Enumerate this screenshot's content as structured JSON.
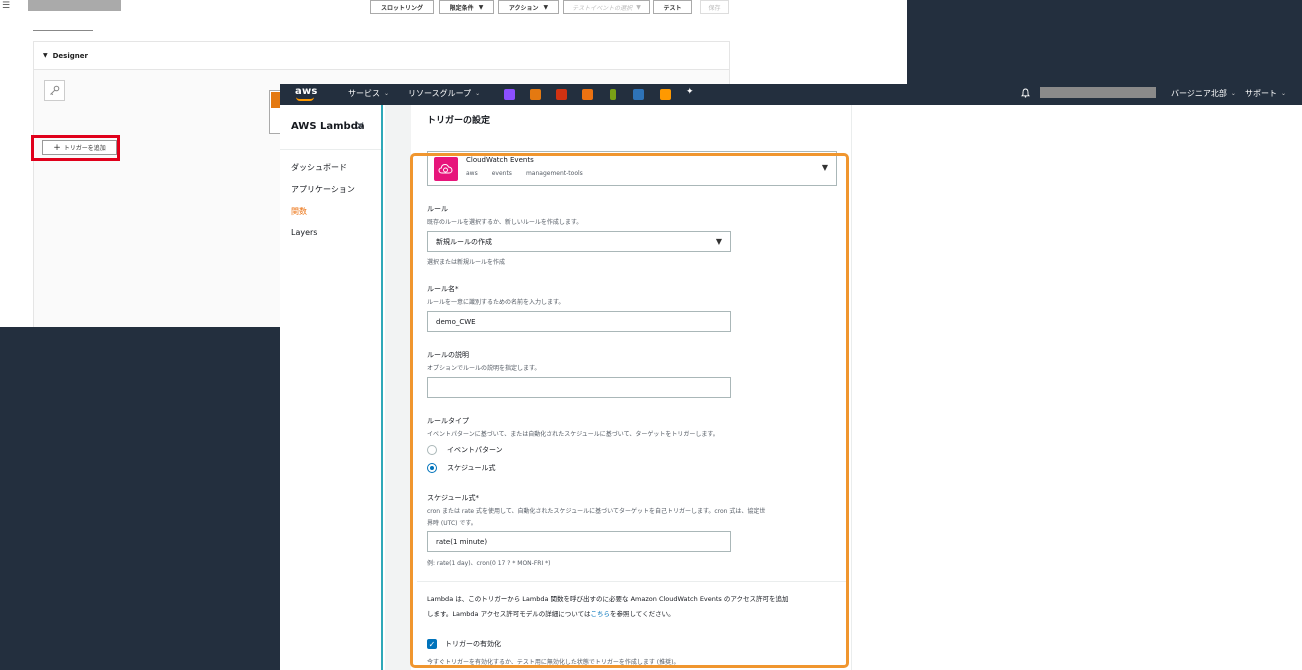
{
  "background_window": {
    "toolbar": {
      "throttling": "スロットリング",
      "qualifiers": "限定条件",
      "actions": "アクション",
      "test_event_placeholder": "テストイベントの選択",
      "test": "テスト",
      "save": "保存"
    },
    "designer_title": "Designer",
    "add_trigger": "トリガーを追加"
  },
  "topnav": {
    "logo": "aws",
    "services": "サービス",
    "resource_groups": "リソースグループ",
    "region": "バージニア北部",
    "support": "サポート",
    "service_icons": [
      {
        "name": "purple-service-icon",
        "color": "#8c4fff"
      },
      {
        "name": "orange-service-icon-1",
        "color": "#e47911"
      },
      {
        "name": "red-service-icon",
        "color": "#d13212"
      },
      {
        "name": "orange-service-icon-2",
        "color": "#ec7211"
      },
      {
        "name": "green-service-icon",
        "color": "#7aa116"
      },
      {
        "name": "blue-service-icon",
        "color": "#2e73b8"
      },
      {
        "name": "orange-service-icon-3",
        "color": "#ff9900"
      },
      {
        "name": "pin-icon",
        "color": "#ffffff"
      }
    ]
  },
  "sidebar": {
    "title": "AWS Lambda",
    "items": [
      {
        "label": "ダッシュボード",
        "active": false
      },
      {
        "label": "アプリケーション",
        "active": false
      },
      {
        "label": "関数",
        "active": true
      },
      {
        "label": "Layers",
        "active": false
      }
    ]
  },
  "trigger_config": {
    "section_title": "トリガーの設定",
    "source": {
      "name": "CloudWatch Events",
      "tags": [
        "aws",
        "events",
        "management-tools"
      ]
    },
    "rule": {
      "label": "ルール",
      "description": "既存のルールを選択するか、新しいルールを作成します。",
      "value": "新規ルールの作成",
      "hint": "選択または新規ルールを作成"
    },
    "rule_name": {
      "label": "ルール名*",
      "description": "ルールを一意に識別するための名前を入力します。",
      "value": "demo_CWE"
    },
    "rule_description": {
      "label": "ルールの説明",
      "description": "オプションでルールの説明を指定します。",
      "value": ""
    },
    "rule_type": {
      "label": "ルールタイプ",
      "description": "イベントパターンに基づいて、または自動化されたスケジュールに基づいて、ターゲットをトリガーします。",
      "options": [
        {
          "label": "イベントパターン",
          "selected": false
        },
        {
          "label": "スケジュール式",
          "selected": true
        }
      ]
    },
    "schedule_expression": {
      "label": "スケジュール式*",
      "description_line1": "cron または rate 式を使用して、自動化されたスケジュールに基づいてターゲットを自己トリガーします。cron 式は、協定世",
      "description_line2": "界時 (UTC) です。",
      "value": "rate(1 minute)",
      "example": "例: rate(1 day)、cron(0 17 ? * MON-FRI *)"
    },
    "permission_note": {
      "line1": "Lambda は、このトリガーから Lambda 関数を呼び出すのに必要な Amazon CloudWatch Events のアクセス許可を追加",
      "line2_prefix": "します。Lambda アクセス許可モデルの詳細については",
      "link": "こちら",
      "line2_suffix": "を参照してください。"
    },
    "enable_trigger": {
      "label": "トリガーの有効化",
      "checked": true,
      "description": "今すぐトリガーを有効化するか、テスト用に無効化した状態でトリガーを作成します (推奨)。"
    }
  },
  "colors": {
    "nav_bg": "#232f3e",
    "accent_orange": "#ec7211",
    "highlight_frame": "#f0962f",
    "highlight_red": "#e0001b",
    "link_blue": "#0073bb",
    "cwe_pink": "#e7157b"
  }
}
